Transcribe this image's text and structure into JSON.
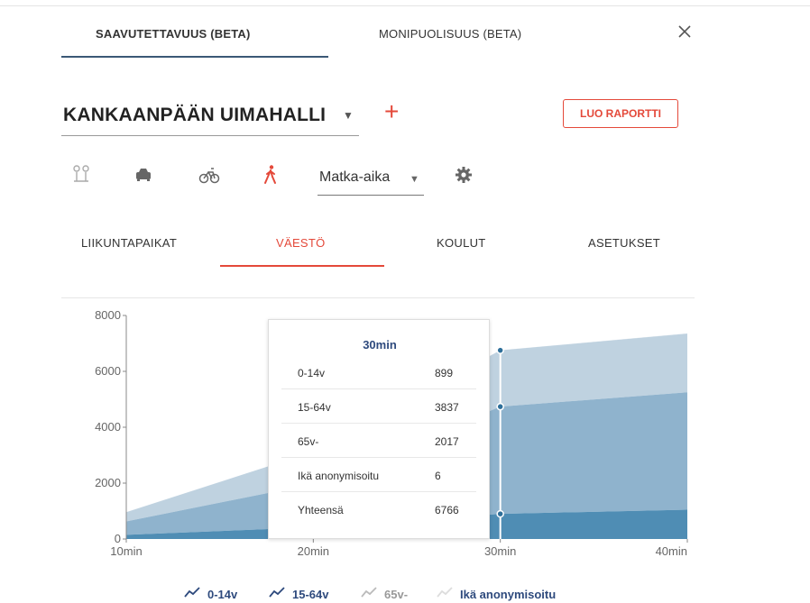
{
  "tabs": {
    "accessibility": "SAAVUTETTAVUUS (BETA)",
    "diversity": "MONIPUOLISUUS (BETA)"
  },
  "place": {
    "name": "KANKAANPÄÄN UIMAHALLI"
  },
  "report_button": "LUO RAPORTTI",
  "travel_metric": "Matka-aika",
  "subtabs": {
    "sports": "LIIKUNTAPAIKAT",
    "population": "VÄESTÖ",
    "schools": "KOULUT",
    "settings": "ASETUKSET"
  },
  "colors": {
    "accent_red": "#e4493a",
    "tab_underline": "#3b5876",
    "series_0_14": "#4f8db4",
    "series_15_64": "#8fb3cd",
    "series_65": "#bfd2e0",
    "series_anon": "#dfe7ee"
  },
  "icons": {
    "transit": "transit-icon",
    "car": "car-icon",
    "bicycle": "bicycle-icon",
    "walk": "walk-icon",
    "settings": "gear-icon",
    "close": "close-icon"
  },
  "chart_data": {
    "type": "area",
    "stacked": true,
    "categories": [
      "10min",
      "20min",
      "30min",
      "40min"
    ],
    "series": [
      {
        "name": "0-14v",
        "values": [
          150,
          420,
          899,
          1050
        ]
      },
      {
        "name": "15-64v",
        "values": [
          480,
          1550,
          3837,
          4200
        ]
      },
      {
        "name": "65v-",
        "values": [
          330,
          1150,
          2017,
          2100
        ]
      },
      {
        "name": "Ikä anonymisoitu",
        "values": [
          2,
          4,
          6,
          7
        ]
      }
    ],
    "ylim": [
      0,
      8000
    ],
    "yticks": [
      "0",
      "2000",
      "4000",
      "6000",
      "8000"
    ],
    "grid": false,
    "legend": "bottom"
  },
  "tooltip": {
    "title": "30min",
    "rows": [
      {
        "label": "0-14v",
        "value": "899"
      },
      {
        "label": "15-64v",
        "value": "3837"
      },
      {
        "label": "65v-",
        "value": "2017"
      },
      {
        "label": "Ikä anonymisoitu",
        "value": "6"
      },
      {
        "label": "Yhteensä",
        "value": "6766"
      }
    ]
  }
}
